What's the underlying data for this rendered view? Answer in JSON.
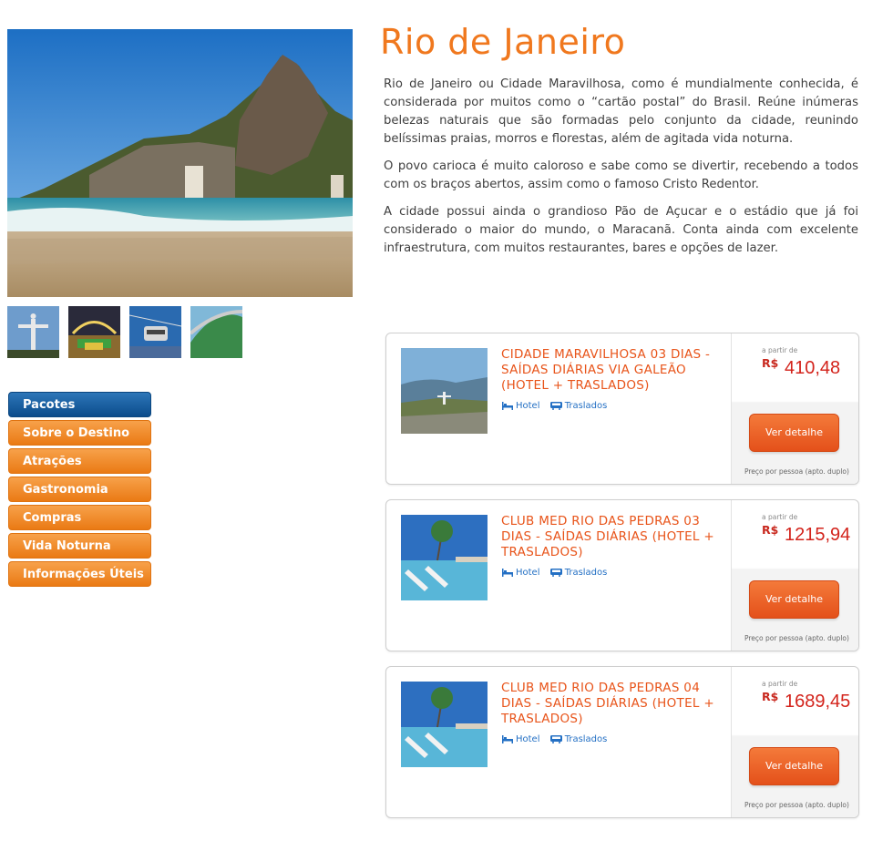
{
  "destination": {
    "title": "Rio de Janeiro",
    "paragraphs": [
      "Rio de Janeiro ou Cidade Maravilhosa, como é mundialmente conhecida, é considerada por muitos como o “cartão postal” do Brasil. Reúne inúmeras belezas naturais que são formadas pelo conjunto da cidade, reunindo belíssimas praias, morros e florestas, além de agitada vida noturna.",
      "O povo carioca é muito caloroso e sabe como se divertir, recebendo a todos com os braços abertos, assim como o famoso Cristo Redentor.",
      "A cidade possui ainda o grandioso Pão de Açucar e o estádio que já foi considerado o maior do mundo, o Maracanã. Conta ainda com excelente infraestrutura, com muitos restaurantes, bares e opções de lazer."
    ]
  },
  "thumbnails": [
    "cristo-redentor",
    "carnaval",
    "bondinho",
    "maracana"
  ],
  "menu": {
    "items": [
      {
        "label": "Pacotes",
        "active": true
      },
      {
        "label": "Sobre o Destino",
        "active": false
      },
      {
        "label": "Atrações",
        "active": false
      },
      {
        "label": "Gastronomia",
        "active": false
      },
      {
        "label": "Compras",
        "active": false
      },
      {
        "label": "Vida Noturna",
        "active": false
      },
      {
        "label": "Informações Úteis",
        "active": false
      }
    ]
  },
  "packages": [
    {
      "title": "CIDADE MARAVILHOSA 03 DIAS - SAÍDAS DIÁRIAS VIA GALEÃO (HOTEL + TRASLADOS)",
      "features": [
        "Hotel",
        "Traslados"
      ],
      "from_label": "a partir de",
      "currency": "R$",
      "price": "410,48",
      "button": "Ver detalhe",
      "note": "Preço por pessoa (apto. duplo)"
    },
    {
      "title": "CLUB MED RIO DAS PEDRAS 03 DIAS - SAÍDAS DIÁRIAS (HOTEL + TRASLADOS)",
      "features": [
        "Hotel",
        "Traslados"
      ],
      "from_label": "a partir de",
      "currency": "R$",
      "price": "1215,94",
      "button": "Ver detalhe",
      "note": "Preço por pessoa (apto. duplo)"
    },
    {
      "title": "CLUB MED RIO DAS PEDRAS 04 DIAS - SAÍDAS DIÁRIAS (HOTEL + TRASLADOS)",
      "features": [
        "Hotel",
        "Traslados"
      ],
      "from_label": "a partir de",
      "currency": "R$",
      "price": "1689,45",
      "button": "Ver detalhe",
      "note": "Preço por pessoa (apto. duplo)"
    }
  ],
  "colors": {
    "title_orange": "#f0781e",
    "package_title": "#e8541a",
    "price_red": "#d3231b",
    "menu_active": "#0b4c8c",
    "menu_orange": "#ea7a14",
    "feature_blue": "#2470c4"
  }
}
